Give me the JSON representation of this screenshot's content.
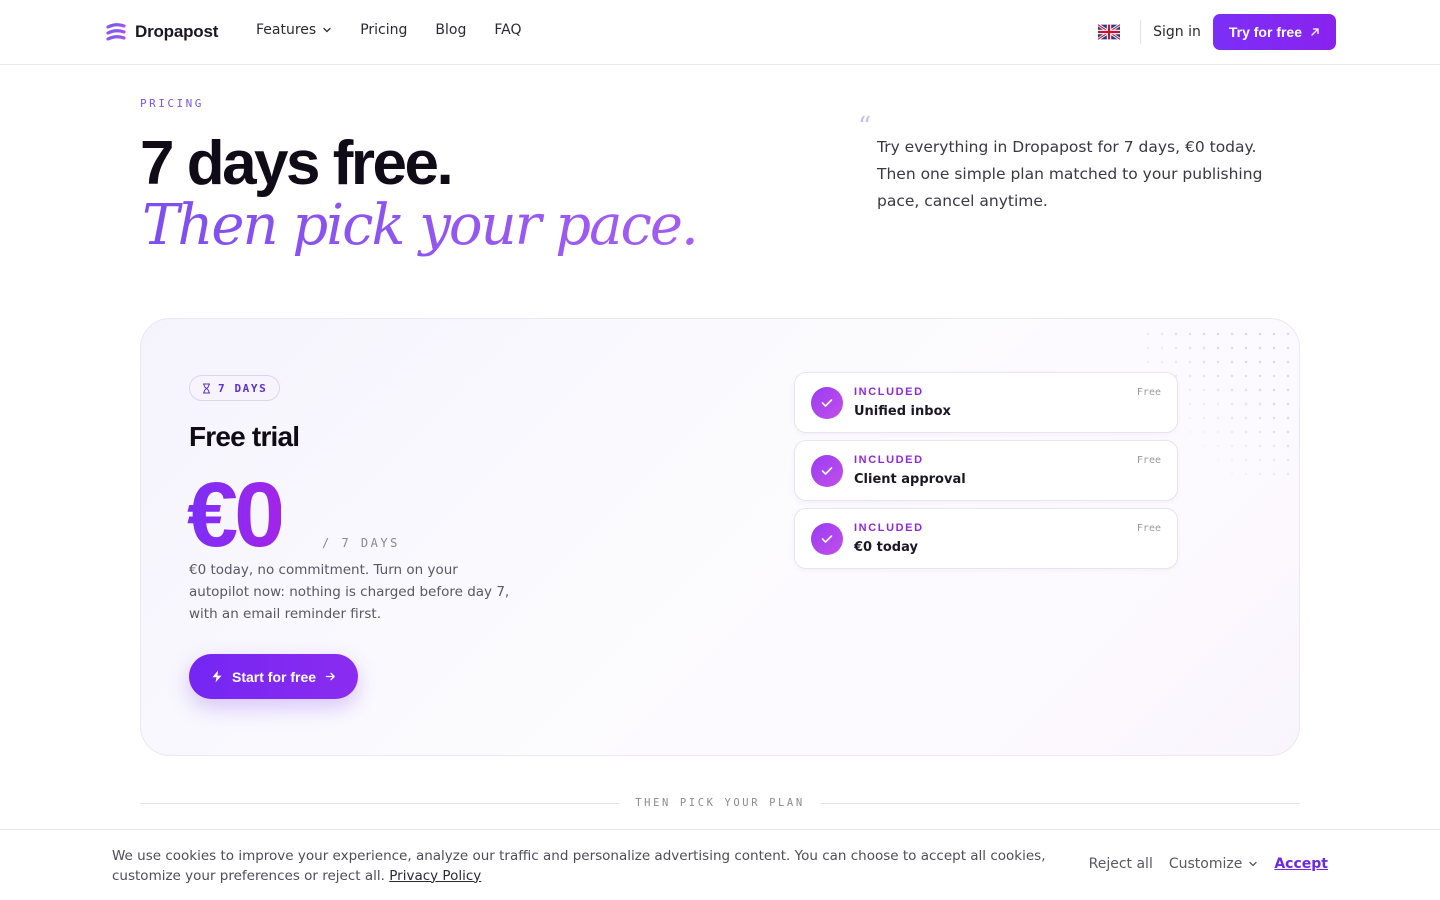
{
  "brand": {
    "name": "Dropapost",
    "accent": "#7c3aed"
  },
  "nav": {
    "links": [
      {
        "label": "Features",
        "has_dropdown": true
      },
      {
        "label": "Pricing"
      },
      {
        "label": "Blog"
      },
      {
        "label": "FAQ"
      }
    ],
    "language_icon": "uk-flag-icon",
    "signin_label": "Sign in",
    "cta_label": "Try for free"
  },
  "hero": {
    "eyebrow": "PRICING",
    "title": "7 days free.",
    "subtitle": "Then pick your pace.",
    "quote": "Try everything in Dropapost for 7 days, €0 today. Then one simple plan matched to your publishing pace, cancel anytime."
  },
  "trial": {
    "badge": "7 DAYS",
    "title": "Free trial",
    "price": "€0",
    "period": "/ 7 DAYS",
    "description": "€0 today, no commitment. Turn on your autopilot now: nothing is charged before day 7, with an email reminder first.",
    "cta_label": "Start for free",
    "features": [
      {
        "tag": "INCLUDED",
        "name": "Unified inbox",
        "price": "Free"
      },
      {
        "tag": "INCLUDED",
        "name": "Client approval",
        "price": "Free"
      },
      {
        "tag": "INCLUDED",
        "name": "€0 today",
        "price": "Free"
      }
    ]
  },
  "divider_label": "THEN PICK YOUR PLAN",
  "cookie": {
    "text": "We use cookies to improve your experience, analyze our traffic and personalize advertising content. You can choose to accept all cookies, customize your preferences or reject all.",
    "privacy_label": "Privacy Policy",
    "reject_label": "Reject all",
    "customize_label": "Customize",
    "accept_label": "Accept"
  }
}
